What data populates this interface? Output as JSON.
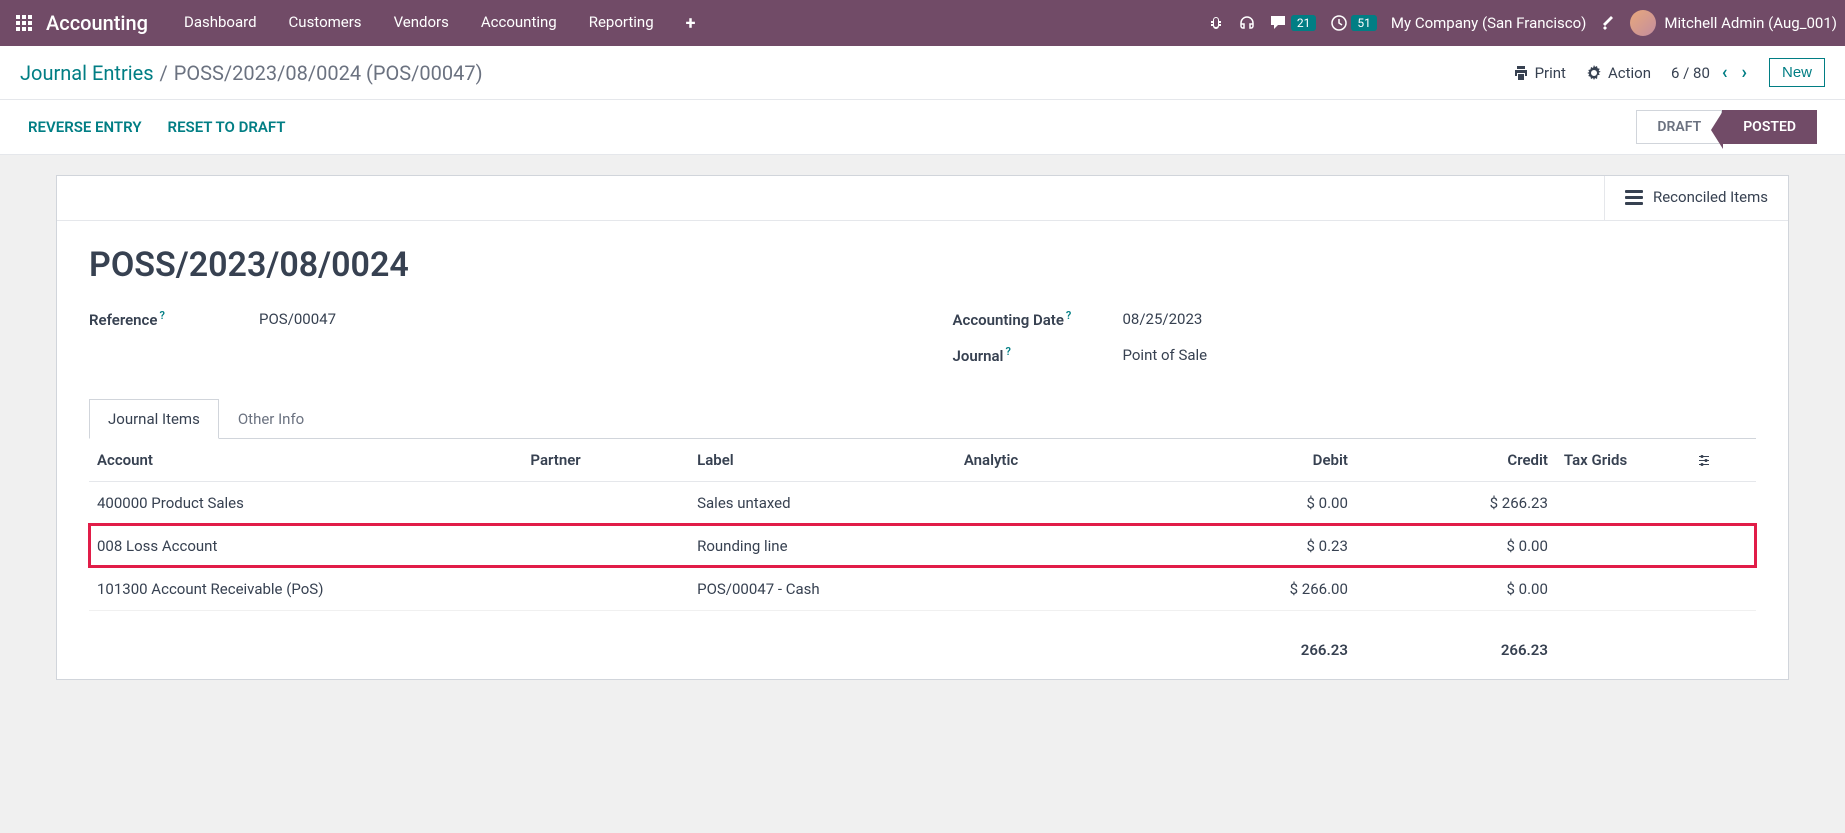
{
  "navbar": {
    "brand": "Accounting",
    "menu": [
      "Dashboard",
      "Customers",
      "Vendors",
      "Accounting",
      "Reporting"
    ],
    "messages_count": "21",
    "activities_count": "51",
    "company": "My Company (San Francisco)",
    "user": "Mitchell Admin (Aug_001)"
  },
  "breadcrumb": {
    "root": "Journal Entries",
    "current": "POSS/2023/08/0024 (POS/00047)"
  },
  "controls": {
    "print": "Print",
    "action": "Action",
    "pager": "6 / 80",
    "new": "New"
  },
  "statusbar": {
    "reverse": "REVERSE ENTRY",
    "reset": "RESET TO DRAFT",
    "draft": "DRAFT",
    "posted": "POSTED"
  },
  "stat": {
    "reconciled": "Reconciled Items"
  },
  "record": {
    "title": "POSS/2023/08/0024",
    "reference_label": "Reference",
    "reference_value": "POS/00047",
    "date_label": "Accounting Date",
    "date_value": "08/25/2023",
    "journal_label": "Journal",
    "journal_value": "Point of Sale"
  },
  "tabs": {
    "items": "Journal Items",
    "other": "Other Info"
  },
  "table": {
    "headers": {
      "account": "Account",
      "partner": "Partner",
      "label": "Label",
      "analytic": "Analytic",
      "debit": "Debit",
      "credit": "Credit",
      "taxgrids": "Tax Grids"
    },
    "rows": [
      {
        "account": "400000 Product Sales",
        "partner": "",
        "label": "Sales untaxed",
        "analytic": "",
        "debit": "$ 0.00",
        "credit": "$ 266.23",
        "taxgrids": "",
        "highlight": false
      },
      {
        "account": "008 Loss Account",
        "partner": "",
        "label": "Rounding line",
        "analytic": "",
        "debit": "$ 0.23",
        "credit": "$ 0.00",
        "taxgrids": "",
        "highlight": true
      },
      {
        "account": "101300 Account Receivable (PoS)",
        "partner": "",
        "label": "POS/00047 - Cash",
        "analytic": "",
        "debit": "$ 266.00",
        "credit": "$ 0.00",
        "taxgrids": "",
        "highlight": false
      }
    ],
    "totals": {
      "debit": "266.23",
      "credit": "266.23"
    }
  }
}
